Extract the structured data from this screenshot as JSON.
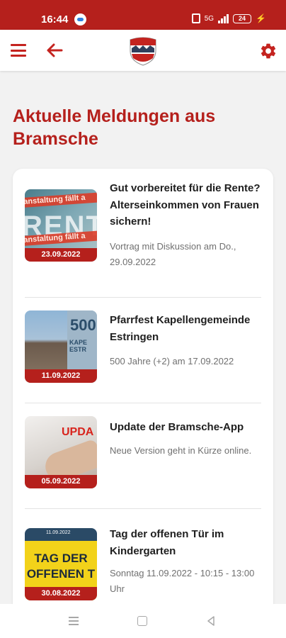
{
  "status_bar": {
    "time": "16:44",
    "battery": "24",
    "network": "5G"
  },
  "header": {
    "menu_icon": "hamburger-menu-icon",
    "back_icon": "arrow-left-icon",
    "logo_icon": "bramsche-crest-icon",
    "settings_icon": "gear-icon",
    "accent_color": "#c4231f"
  },
  "page": {
    "title": "Aktuelle Meldungen aus Bramsche"
  },
  "news": [
    {
      "date": "23.09.2022",
      "title": "Gut vorbereitet für die Rente? Alterseinkommen von Frauen sichern!",
      "subtitle": "Vortrag mit Diskussion am Do., 29.09.2022",
      "thumb_text_top": "ranstaltung fällt a",
      "thumb_text_main": "RENTE",
      "thumb_text_bottom": "ranstaltung fällt a"
    },
    {
      "date": "11.09.2022",
      "title": "Pfarrfest Kapellengemeinde Estringen",
      "subtitle": "500 Jahre (+2) am 17.09.2022",
      "thumb_text_main": "500",
      "thumb_text_sub": "KAPE ESTR"
    },
    {
      "date": "05.09.2022",
      "title": "Update der Bramsche-App",
      "subtitle": "Neue Version geht in Kürze online.",
      "thumb_text_main": "UPDA"
    },
    {
      "date": "30.08.2022",
      "title": "Tag der offenen Tür im Kindergarten",
      "subtitle": "Sonntag 11.09.2022 - 10:15 - 13:00 Uhr",
      "thumb_text_top": "11.09.2022",
      "thumb_text_main": "TAG DER OFFENEN T"
    }
  ],
  "nav_bar": {
    "recents_icon": "recents-icon",
    "home_icon": "home-icon",
    "back_icon": "back-triangle-icon"
  }
}
